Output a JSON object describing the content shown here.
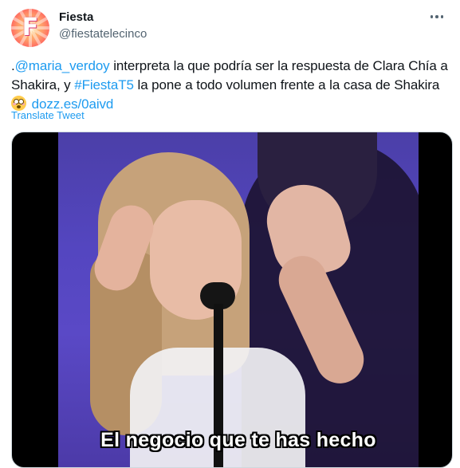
{
  "author": {
    "display_name": "Fiesta",
    "handle": "@fiestatelecinco",
    "avatar_letter": "F",
    "avatar_icon": "fiesta-logo"
  },
  "tweet": {
    "text_parts": [
      {
        "text": ".",
        "link": false
      },
      {
        "text": "@maria_verdoy",
        "link": true
      },
      {
        "text": " interpreta la que podría ser la respuesta de Clara Chía a Shakira, y ",
        "link": false
      },
      {
        "text": "#FiestaT5",
        "link": true
      },
      {
        "text": " la pone a todo volumen frente a la casa de Shakira ",
        "link": false
      }
    ],
    "emoji": "flushed-face",
    "link_text": "dozz.es/0aivd",
    "translate_label": "Translate Tweet"
  },
  "media": {
    "caption": "El negocio que te has hecho"
  },
  "colors": {
    "link": "#1d9bf0",
    "secondary_text": "#536471",
    "video_bg": "#5446c0"
  }
}
